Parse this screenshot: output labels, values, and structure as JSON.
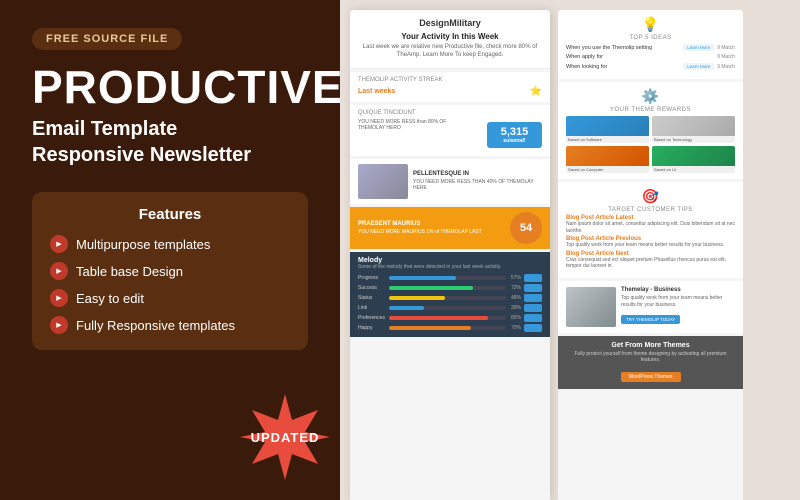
{
  "left": {
    "badge_label": "FREE SOURCE FILE",
    "main_title": "PRODUCTIVE",
    "sub_title_line1": "Email Template",
    "sub_title_line2": "Responsive Newsletter",
    "features_heading": "Features",
    "features": [
      {
        "id": "f1",
        "text": "Multipurpose templates"
      },
      {
        "id": "f2",
        "text": "Table base Design"
      },
      {
        "id": "f3",
        "text": "Easy to edit"
      },
      {
        "id": "f4",
        "text": "Fully Responsive templates"
      }
    ],
    "updated_label": "UPDATED"
  },
  "email_preview": {
    "logo": "DesignMilitary",
    "hero_title": "Your Activity In this Week",
    "hero_sub": "Last week we are relative new Productive file, check more 80% of TheAmp. Learn More To keep Engaged.",
    "streak_label": "THEMOLIP ACTIVITY STREAK",
    "streak_period": "Last weeks",
    "stat_number": "5,315",
    "stat_sub": "euismod!",
    "stat_label": "QUIQUE TINCIDUNT",
    "pellentesque": "PELLENTESQUE IN",
    "praesent": "PRAESENT MAURIUS",
    "praesent_num": "54",
    "melody_label": "Melody",
    "melody_sub": "Some of the melody that were detected in your last week activity.",
    "bars": [
      {
        "name": "Progress",
        "pct": 57,
        "color": "blue"
      },
      {
        "name": "Success",
        "pct": 72,
        "color": "green"
      },
      {
        "name": "Status",
        "pct": 48,
        "color": "yellow"
      },
      {
        "name": "Link",
        "pct": 30,
        "color": "blue"
      },
      {
        "name": "Preferences",
        "pct": 85,
        "color": "red"
      },
      {
        "name": "Happy",
        "pct": 70,
        "color": "orange"
      }
    ],
    "right_sections": {
      "top_ideas_title": "TOP 5 IDEAS",
      "top_ideas_links": [
        {
          "text": "When you use the Themolip setting",
          "btn": "Learn More",
          "num": "9 Match"
        },
        {
          "text": "When apply for",
          "btn": "",
          "num": "9 Match"
        },
        {
          "text": "When looking for",
          "btn": "Learn More",
          "num": "9 Match"
        }
      ],
      "theme_rewards_title": "YOUR THEME REWARDS",
      "theme_items": [
        {
          "label": "Based on Software"
        },
        {
          "label": "Based on Technology"
        },
        {
          "label": "Saved on Computer"
        },
        {
          "label": "Saved on Ul"
        }
      ],
      "customer_tips_title": "TARGET CUSTOMER TIPS",
      "blog_posts": [
        {
          "title": "Blog Post Article Latest",
          "text": "Nam ipsum dolor sit amet, consettur adipiscing elit. Duis bibendum sit at nec laorthe."
        },
        {
          "title": "Blog Post Article Previous",
          "text": "Top quality work from your team means better results for your business."
        },
        {
          "title": "Blog Post Article Next",
          "text": "Cras consequat sed ect aliquet pretium Phasellus rhoncus purus est elit, tempor dui laoreet in."
        }
      ],
      "business_title": "Themelay - Business",
      "business_sub": "Top quality work from your team means better results for your business.",
      "business_btn": "TRY THEMOLIP TODAY",
      "cta_title": "Get From More Themes",
      "cta_sub": "Fully protect yourself from theme designing by activating all premium features.",
      "cta_btn": "WordPress Themes"
    }
  }
}
